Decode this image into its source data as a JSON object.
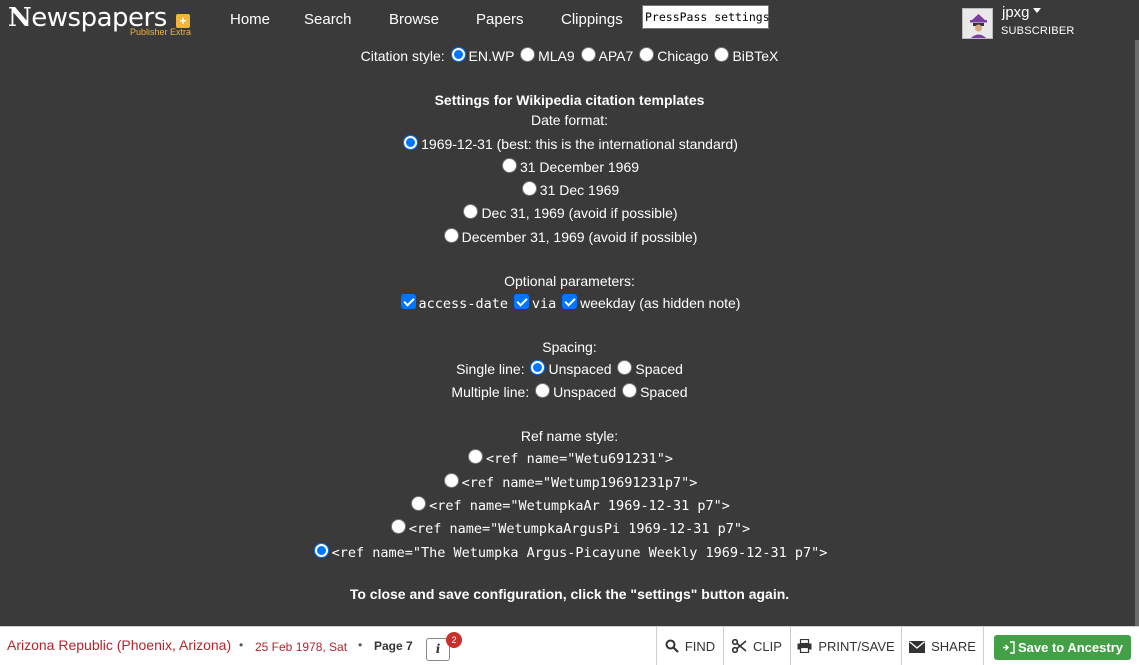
{
  "brand": {
    "logo_text": "Newspapers",
    "logo_first": "N",
    "logo_rest": "ewspapers",
    "sub": "Publisher Extra",
    "plus": "+",
    "accent": "#f0b63b"
  },
  "nav": {
    "items": [
      "Home",
      "Search",
      "Browse",
      "Papers",
      "Clippings"
    ],
    "presspass": "PressPass settings"
  },
  "user": {
    "name": "jpxg",
    "tag": "SUBSCRIBER"
  },
  "settings": {
    "citation": {
      "label": "Citation style:",
      "options": [
        "EN.WP",
        "MLA9",
        "APA7",
        "Chicago",
        "BiBTeX"
      ],
      "selected": "EN.WP"
    },
    "wiki_heading": "Settings for Wikipedia citation templates",
    "date": {
      "label": "Date format:",
      "options": [
        "1969-12-31 (best: this is the international standard)",
        "31 December 1969",
        "31 Dec 1969",
        "Dec 31, 1969 (avoid if possible)",
        "December 31, 1969 (avoid if possible)"
      ],
      "selected_index": 0
    },
    "optional": {
      "label": "Optional parameters:",
      "items": [
        {
          "label": "access-date",
          "checked": true
        },
        {
          "label": "via",
          "checked": true
        },
        {
          "label": "weekday (as hidden note)",
          "checked": true
        }
      ]
    },
    "spacing": {
      "label": "Spacing:",
      "single_label": "Single line:",
      "multiple_label": "Multiple line:",
      "unspaced": "Unspaced",
      "spaced": "Spaced",
      "single_selected": "Unspaced",
      "multiple_selected": null
    },
    "refname": {
      "label": "Ref name style:",
      "options": [
        "<ref name=\"Wetu691231\">",
        "<ref name=\"Wetump19691231p7\">",
        "<ref name=\"WetumpkaAr 1969-12-31 p7\">",
        "<ref name=\"WetumpkaArgusPi 1969-12-31 p7\">",
        "<ref name=\"The Wetumpka Argus-Picayune Weekly 1969-12-31 p7\">"
      ],
      "selected_index": 4
    },
    "close_note": "To close and save configuration, click the \"settings\" button again."
  },
  "footer": {
    "paper": "Arizona Republic (Phoenix, Arizona)",
    "sep": "•",
    "date": "25 Feb 1978, Sat",
    "page": "Page 7",
    "info_icon": "i",
    "badge": "2",
    "tools": {
      "find": "FIND",
      "clip": "CLIP",
      "print": "PRINT/SAVE",
      "share": "SHARE"
    },
    "ancestry": "Save to Ancestry",
    "ancestry_color": "#43a047",
    "link_color": "#b4252c"
  },
  "colors": {
    "background": "#3a3a3a",
    "radio_selected": "#0075ff"
  }
}
